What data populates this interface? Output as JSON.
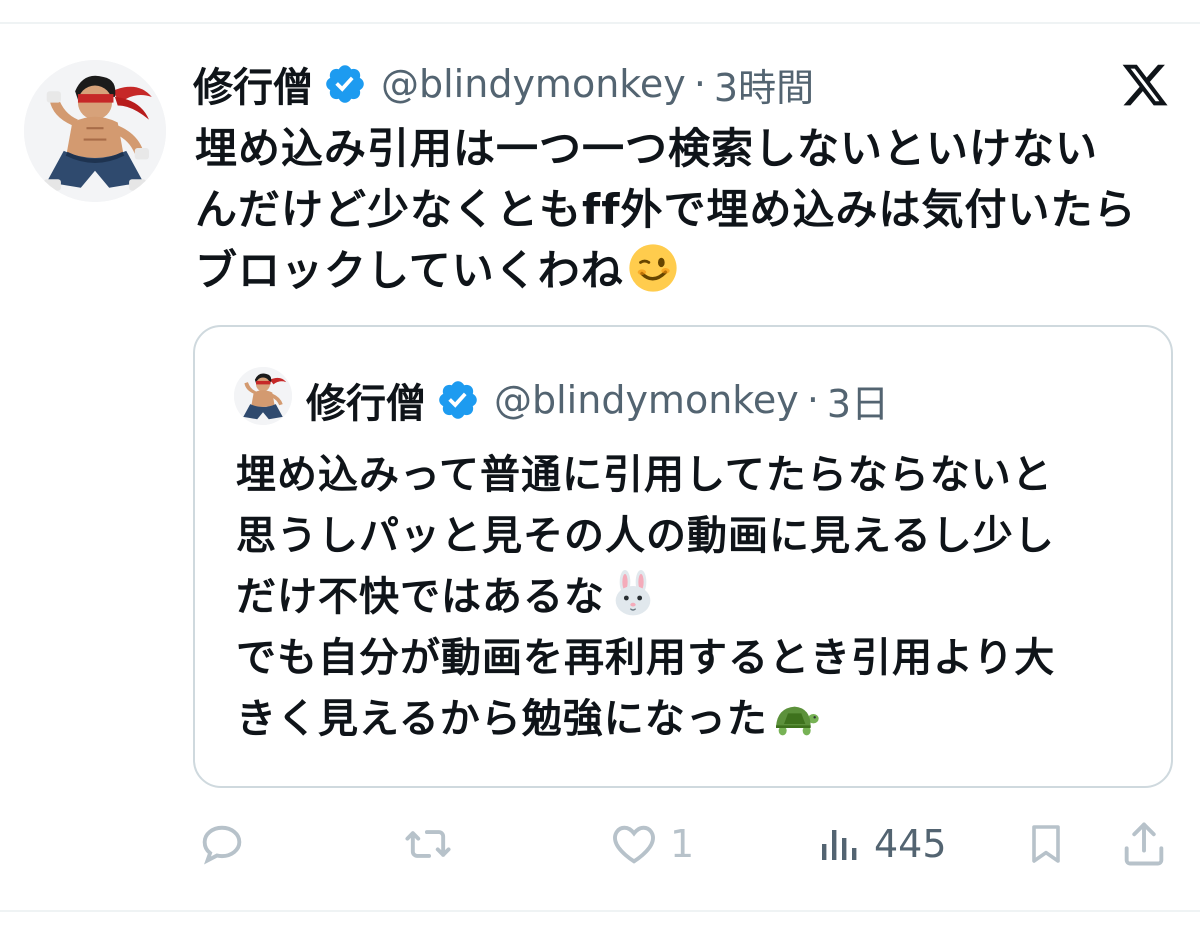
{
  "tweet": {
    "author": {
      "display_name": "修行僧",
      "handle": "@blindymonkey",
      "verified": true,
      "avatar_icon": "ninja-avatar-icon"
    },
    "separator": "·",
    "timestamp": "3時間",
    "text_lines": [
      "埋め込み引用は一つ一つ検索しないといけない",
      "んだけど少なくともff外で埋め込みは気付いたら",
      "ブロックしていくわね"
    ],
    "trailing_emoji": "wink-face-emoji"
  },
  "quoted_tweet": {
    "author": {
      "display_name": "修行僧",
      "handle": "@blindymonkey",
      "verified": true
    },
    "separator": "·",
    "timestamp": "3日",
    "text_lines": [
      "埋め込みって普通に引用してたらならないと",
      "思うしパッと見その人の動画に見えるし少し",
      "だけ不快ではあるな",
      "でも自分が動画を再利用するとき引用より大",
      "きく見えるから勉強になった"
    ],
    "emojis": [
      "rabbit-face-emoji",
      "turtle-emoji"
    ]
  },
  "actions": {
    "reply_count": "",
    "repost_count": "",
    "like_count": "1",
    "views_count": "445"
  },
  "colors": {
    "verified_blue": "#1d9bf0",
    "text_primary": "#0f1419",
    "text_secondary": "#536471",
    "icon_muted": "#b7c2ca",
    "border": "#cfd9de"
  }
}
